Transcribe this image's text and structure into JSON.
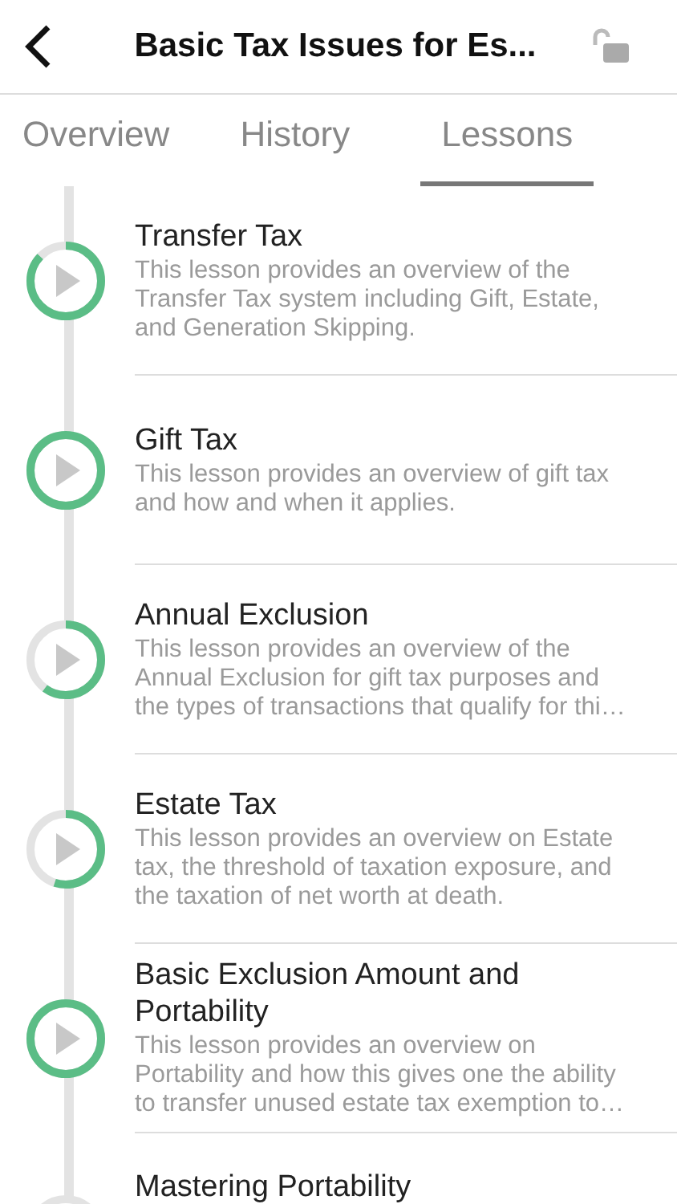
{
  "header": {
    "title": "Basic Tax Issues for Es..."
  },
  "tabs": [
    {
      "label": "Overview",
      "selected": false
    },
    {
      "label": "History",
      "selected": false
    },
    {
      "label": "Lessons",
      "selected": true
    }
  ],
  "lessons": [
    {
      "title": "Transfer Tax",
      "description": "This lesson provides an overview of the Transfer Tax system including Gift, Estate, and Generation Skipping.",
      "level": 0.87
    },
    {
      "title": "Gift Tax",
      "description": "This lesson provides an overview of gift tax and how and when it applies.",
      "level": 1
    },
    {
      "title": "Annual Exclusion",
      "description": "This lesson provides an overview of the Annual Exclusion for gift tax purposes and the types of transactions that qualify for thi…",
      "level": 0.6
    },
    {
      "title": "Estate Tax",
      "description": "This lesson provides an overview on Estate tax, the threshold of taxation exposure, and the taxation of net worth at death.",
      "level": 0.55
    },
    {
      "title": "Basic Exclusion Amount and Portability",
      "description": "This lesson provides an overview on Portability and how this gives one the ability to transfer unused estate tax exemption to…",
      "level": 1
    },
    {
      "title": "Mastering Portability"
    }
  ]
}
